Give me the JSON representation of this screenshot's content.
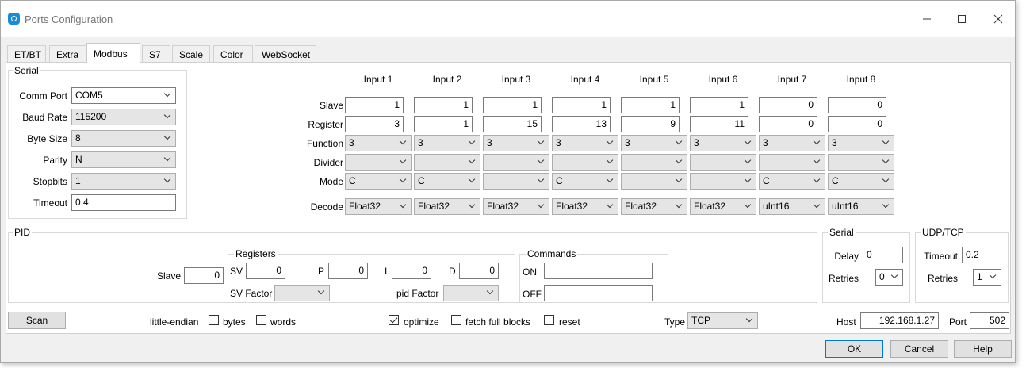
{
  "window": {
    "title": "Ports Configuration"
  },
  "tabs": [
    {
      "label": "ET/BT"
    },
    {
      "label": "Extra"
    },
    {
      "label": "Modbus"
    },
    {
      "label": "S7"
    },
    {
      "label": "Scale"
    },
    {
      "label": "Color"
    },
    {
      "label": "WebSocket"
    }
  ],
  "serial": {
    "title": "Serial",
    "comm_port": {
      "label": "Comm Port",
      "value": "COM5"
    },
    "baud_rate": {
      "label": "Baud Rate",
      "value": "115200"
    },
    "byte_size": {
      "label": "Byte Size",
      "value": "8"
    },
    "parity": {
      "label": "Parity",
      "value": "N"
    },
    "stopbits": {
      "label": "Stopbits",
      "value": "1"
    },
    "timeout": {
      "label": "Timeout",
      "value": "0.4"
    }
  },
  "inputs": {
    "row_labels": {
      "slave": "Slave",
      "register": "Register",
      "function": "Function",
      "divider": "Divider",
      "mode": "Mode",
      "decode": "Decode"
    },
    "columns": [
      {
        "header": "Input 1",
        "slave": "1",
        "register": "3",
        "function": "3",
        "divider": "",
        "mode": "C",
        "decode": "Float32"
      },
      {
        "header": "Input 2",
        "slave": "1",
        "register": "1",
        "function": "3",
        "divider": "",
        "mode": "C",
        "decode": "Float32"
      },
      {
        "header": "Input 3",
        "slave": "1",
        "register": "15",
        "function": "3",
        "divider": "",
        "mode": "",
        "decode": "Float32"
      },
      {
        "header": "Input 4",
        "slave": "1",
        "register": "13",
        "function": "3",
        "divider": "",
        "mode": "C",
        "decode": "Float32"
      },
      {
        "header": "Input 5",
        "slave": "1",
        "register": "9",
        "function": "3",
        "divider": "",
        "mode": "",
        "decode": "Float32"
      },
      {
        "header": "Input 6",
        "slave": "1",
        "register": "11",
        "function": "3",
        "divider": "",
        "mode": "",
        "decode": "Float32"
      },
      {
        "header": "Input 7",
        "slave": "0",
        "register": "0",
        "function": "3",
        "divider": "",
        "mode": "C",
        "decode": "uInt16"
      },
      {
        "header": "Input 8",
        "slave": "0",
        "register": "0",
        "function": "3",
        "divider": "",
        "mode": "C",
        "decode": "uInt16"
      }
    ]
  },
  "pid": {
    "title": "PID",
    "slave_label": "Slave",
    "slave_value": "0",
    "registers_title": "Registers",
    "sv_label": "SV",
    "sv_value": "0",
    "p_label": "P",
    "p_value": "0",
    "i_label": "I",
    "i_value": "0",
    "d_label": "D",
    "d_value": "0",
    "sv_factor_label": "SV Factor",
    "sv_factor_value": "",
    "pid_factor_label": "pid Factor",
    "pid_factor_value": "",
    "commands_title": "Commands",
    "on_label": "ON",
    "on_value": "",
    "off_label": "OFF",
    "off_value": ""
  },
  "serial2": {
    "title": "Serial",
    "delay_label": "Delay",
    "delay_value": "0",
    "retries_label": "Retries",
    "retries_value": "0"
  },
  "udp": {
    "title": "UDP/TCP",
    "timeout_label": "Timeout",
    "timeout_value": "0.2",
    "retries_label": "Retries",
    "retries_value": "1"
  },
  "bottom": {
    "scan_label": "Scan",
    "little_endian_label": "little-endian",
    "bytes_label": "bytes",
    "bytes_checked": false,
    "words_label": "words",
    "words_checked": false,
    "optimize_label": "optimize",
    "optimize_checked": true,
    "fetch_label": "fetch full blocks",
    "fetch_checked": false,
    "reset_label": "reset",
    "reset_checked": false,
    "type_label": "Type",
    "type_value": "TCP",
    "host_label": "Host",
    "host_value": "192.168.1.27",
    "port_label": "Port",
    "port_value": "502"
  },
  "buttons": {
    "ok": "OK",
    "cancel": "Cancel",
    "help": "Help"
  }
}
